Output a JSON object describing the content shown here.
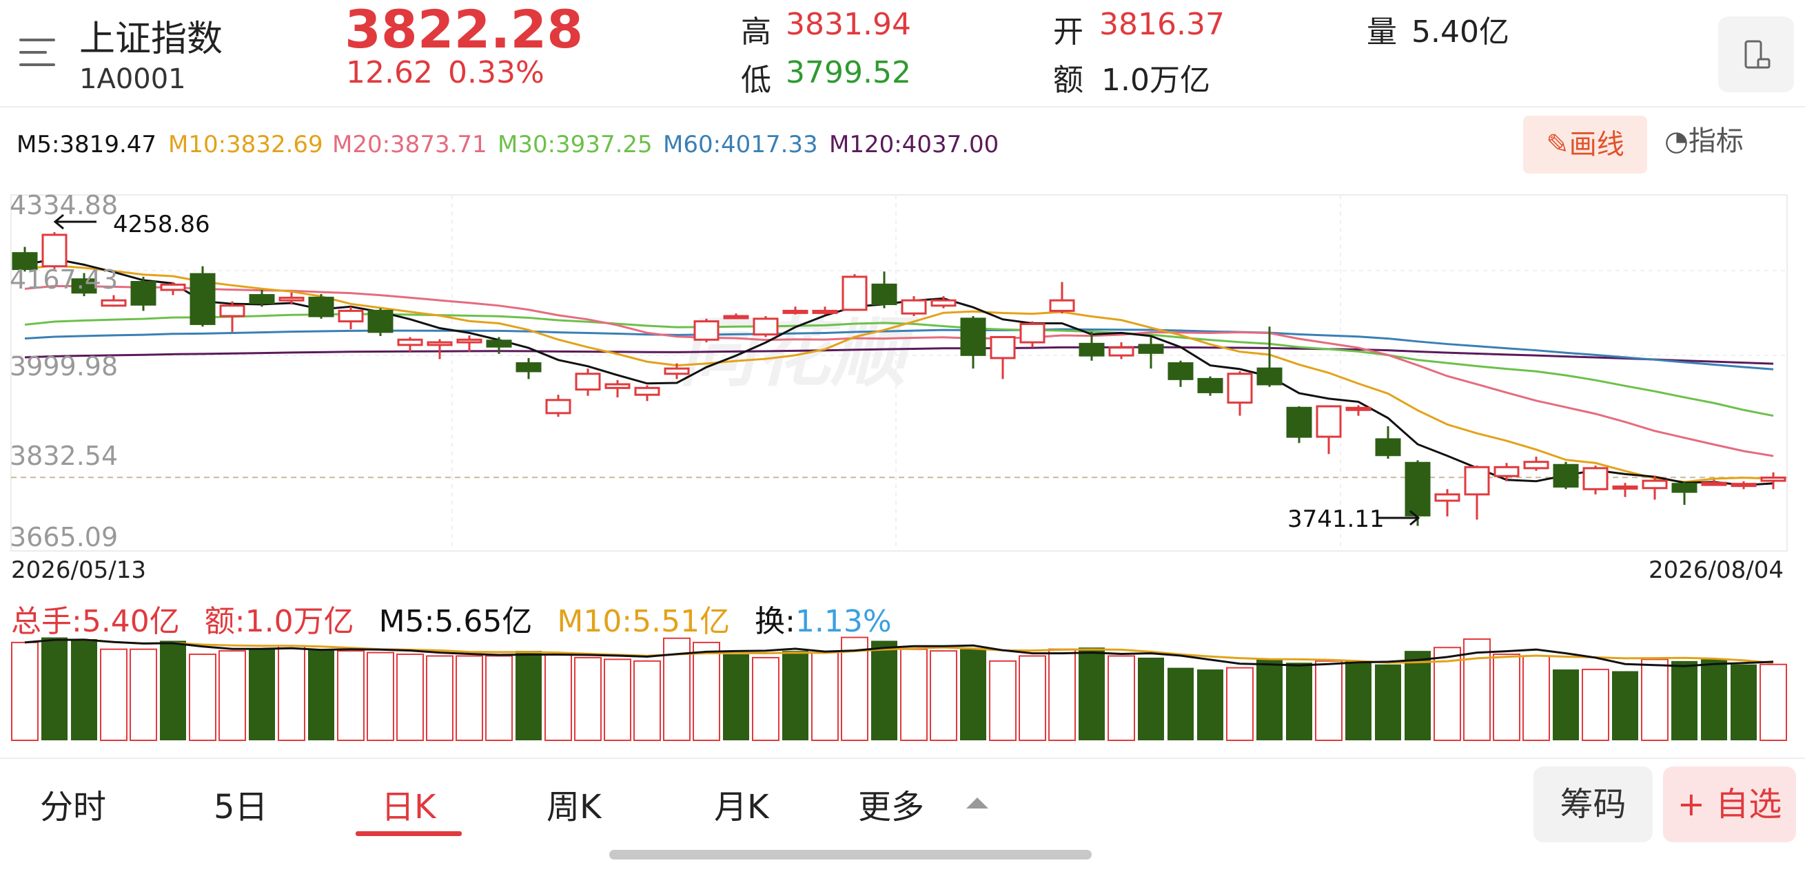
{
  "header": {
    "name": "上证指数",
    "code": "1A0001",
    "price": "3822.28",
    "change": "12.62",
    "change_pct": "0.33%",
    "high_label": "高",
    "high_value": "3831.94",
    "low_label": "低",
    "low_value": "3799.52",
    "open_label": "开",
    "open_value": "3816.37",
    "amount_label": "额",
    "amount_value": "1.0万亿",
    "volume_label": "量",
    "volume_value": "5.40亿"
  },
  "ma_bar": {
    "m5": "M5:3819.47",
    "m10": "M10:3832.69",
    "m20": "M20:3873.71",
    "m30": "M30:3937.25",
    "m60": "M60:4017.33",
    "m120": "M120:4037.00",
    "draw_label": "画线",
    "indicator_label": "指标"
  },
  "chart": {
    "y_ticks": [
      "4334.88",
      "4167.43",
      "3999.98",
      "3832.54",
      "3665.09"
    ],
    "max_label": "4258.86",
    "min_label": "3741.11",
    "start_date": "2026/05/13",
    "end_date": "2026/08/04",
    "watermark": "同花顺"
  },
  "volume_bar": {
    "total": "总手:5.40亿",
    "amount": "额:1.0万亿",
    "m5": "M5:5.65亿",
    "m10": "M10:5.51亿",
    "turnover_label": "换:",
    "turnover_value": "1.13%"
  },
  "colors": {
    "up": "#e03a3e",
    "down": "#2d5e14",
    "m5": "#111111",
    "m10": "#e3a21a",
    "m20": "#e56b7e",
    "m30": "#6cc04a",
    "m60": "#3a7fb5",
    "m120": "#5a1a5a"
  },
  "tabs": [
    {
      "label": "分时"
    },
    {
      "label": "5日"
    },
    {
      "label": "日K"
    },
    {
      "label": "周K"
    },
    {
      "label": "月K"
    },
    {
      "label": "更多"
    }
  ],
  "buttons": {
    "chips": "筹码",
    "watchlist": "+ 自选"
  },
  "chart_data": {
    "type": "candlestick",
    "y_range": [
      3665.09,
      4334.88
    ],
    "x_range": [
      "2026/05/13",
      "2026/08/04"
    ],
    "candles": [
      [
        4250,
        4220,
        4262,
        4215
      ],
      [
        4225,
        4285,
        4290,
        4220
      ],
      [
        4200,
        4175,
        4212,
        4168
      ],
      [
        4150,
        4160,
        4170,
        4148
      ],
      [
        4195,
        4152,
        4205,
        4140
      ],
      [
        4180,
        4190,
        4195,
        4170
      ],
      [
        4210,
        4115,
        4225,
        4110
      ],
      [
        4130,
        4150,
        4158,
        4100
      ],
      [
        4170,
        4155,
        4180,
        4148
      ],
      [
        4160,
        4165,
        4175,
        4152
      ],
      [
        4165,
        4130,
        4172,
        4125
      ],
      [
        4120,
        4140,
        4148,
        4105
      ],
      [
        4140,
        4100,
        4145,
        4092
      ],
      [
        4075,
        4085,
        4090,
        4062
      ],
      [
        4075,
        4080,
        4086,
        4048
      ],
      [
        4080,
        4085,
        4093,
        4062
      ],
      [
        4083,
        4072,
        4090,
        4058
      ],
      [
        4040,
        4025,
        4050,
        4010
      ],
      [
        3945,
        3970,
        3980,
        3938
      ],
      [
        3990,
        4020,
        4030,
        3978
      ],
      [
        3993,
        4000,
        4008,
        3975
      ],
      [
        3980,
        3993,
        3998,
        3968
      ],
      [
        4020,
        4030,
        4040,
        4010
      ],
      [
        4085,
        4120,
        4125,
        4080
      ],
      [
        4130,
        4130,
        4135,
        4125
      ],
      [
        4095,
        4125,
        4130,
        4090
      ],
      [
        4140,
        4140,
        4148,
        4133
      ],
      [
        4140,
        4140,
        4148,
        4133
      ],
      [
        4142,
        4205,
        4210,
        4140
      ],
      [
        4190,
        4153,
        4215,
        4145
      ],
      [
        4135,
        4160,
        4168,
        4130
      ],
      [
        4150,
        4160,
        4168,
        4145
      ],
      [
        4125,
        4056,
        4130,
        4030
      ],
      [
        4050,
        4090,
        4092,
        4010
      ],
      [
        4080,
        4115,
        4120,
        4070
      ],
      [
        4140,
        4160,
        4195,
        4135
      ],
      [
        4077,
        4055,
        4100,
        4045
      ],
      [
        4055,
        4070,
        4080,
        4048
      ],
      [
        4075,
        4060,
        4090,
        4030
      ],
      [
        4040,
        4010,
        4045,
        3995
      ],
      [
        4010,
        3985,
        4015,
        3978
      ],
      [
        3965,
        4020,
        4025,
        3940
      ],
      [
        4030,
        4000,
        4110,
        3995
      ],
      [
        3955,
        3900,
        3958,
        3888
      ],
      [
        3900,
        3958,
        3960,
        3867
      ],
      [
        3955,
        3955,
        3960,
        3940
      ],
      [
        3895,
        3865,
        3920,
        3858
      ],
      [
        3850,
        3750,
        3855,
        3730
      ],
      [
        3778,
        3790,
        3800,
        3748
      ],
      [
        3790,
        3842,
        3845,
        3742
      ],
      [
        3825,
        3842,
        3850,
        3815
      ],
      [
        3840,
        3852,
        3862,
        3835
      ],
      [
        3846,
        3805,
        3852,
        3800
      ],
      [
        3800,
        3840,
        3845,
        3790
      ],
      [
        3805,
        3805,
        3812,
        3785
      ],
      [
        3802,
        3816,
        3826,
        3780
      ],
      [
        3810,
        3795,
        3815,
        3770
      ],
      [
        3812,
        3812,
        3818,
        3808
      ],
      [
        3808,
        3810,
        3815,
        3800
      ],
      [
        3816,
        3822,
        3832,
        3800
      ]
    ],
    "volumes": [
      [
        5.8,
        1
      ],
      [
        6.1,
        0
      ],
      [
        6.0,
        0
      ],
      [
        5.4,
        1
      ],
      [
        5.4,
        1
      ],
      [
        5.9,
        0
      ],
      [
        5.1,
        1
      ],
      [
        5.3,
        1
      ],
      [
        5.4,
        0
      ],
      [
        5.6,
        1
      ],
      [
        5.4,
        0
      ],
      [
        5.3,
        1
      ],
      [
        5.2,
        1
      ],
      [
        5.1,
        1
      ],
      [
        5.0,
        1
      ],
      [
        5.0,
        1
      ],
      [
        5.0,
        1
      ],
      [
        5.3,
        0
      ],
      [
        5.1,
        1
      ],
      [
        4.9,
        1
      ],
      [
        4.8,
        1
      ],
      [
        4.7,
        1
      ],
      [
        6.05,
        1
      ],
      [
        5.8,
        1
      ],
      [
        5.1,
        0
      ],
      [
        4.9,
        1
      ],
      [
        5.3,
        0
      ],
      [
        5.2,
        1
      ],
      [
        6.1,
        1
      ],
      [
        5.9,
        0
      ],
      [
        5.4,
        1
      ],
      [
        5.3,
        1
      ],
      [
        5.4,
        0
      ],
      [
        4.7,
        1
      ],
      [
        5.0,
        1
      ],
      [
        5.4,
        1
      ],
      [
        5.5,
        0
      ],
      [
        5.0,
        1
      ],
      [
        4.9,
        0
      ],
      [
        4.3,
        0
      ],
      [
        4.2,
        0
      ],
      [
        4.3,
        1
      ],
      [
        4.8,
        0
      ],
      [
        4.6,
        0
      ],
      [
        4.7,
        1
      ],
      [
        4.7,
        0
      ],
      [
        4.5,
        0
      ],
      [
        5.3,
        0
      ],
      [
        5.5,
        1
      ],
      [
        6.0,
        1
      ],
      [
        5.1,
        1
      ],
      [
        5.0,
        1
      ],
      [
        4.2,
        0
      ],
      [
        4.2,
        1
      ],
      [
        4.1,
        0
      ],
      [
        4.8,
        1
      ],
      [
        4.7,
        0
      ],
      [
        4.8,
        0
      ],
      [
        4.5,
        0
      ],
      [
        4.5,
        1
      ]
    ]
  }
}
